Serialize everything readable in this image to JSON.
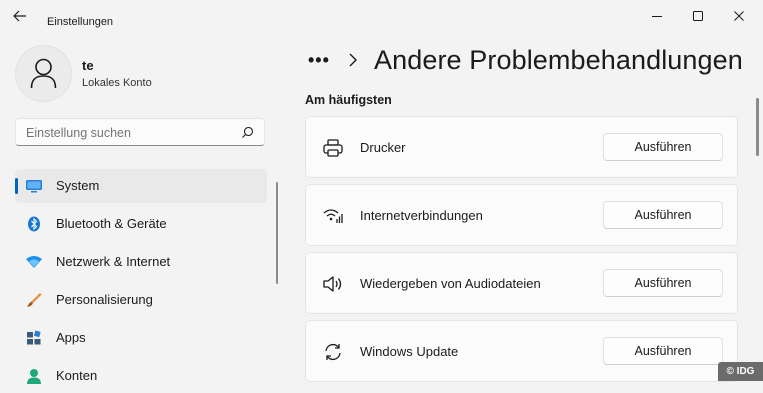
{
  "window": {
    "title": "Einstellungen"
  },
  "user": {
    "name": "te",
    "account_type": "Lokales Konto"
  },
  "search": {
    "placeholder": "Einstellung suchen"
  },
  "sidebar": {
    "items": [
      {
        "label": "System",
        "icon": "monitor-icon",
        "active": true
      },
      {
        "label": "Bluetooth & Geräte",
        "icon": "bluetooth-icon",
        "active": false
      },
      {
        "label": "Netzwerk & Internet",
        "icon": "wifi-icon",
        "active": false
      },
      {
        "label": "Personalisierung",
        "icon": "brush-icon",
        "active": false
      },
      {
        "label": "Apps",
        "icon": "apps-icon",
        "active": false
      },
      {
        "label": "Konten",
        "icon": "person-icon",
        "active": false
      }
    ]
  },
  "breadcrumb": {
    "more": "•••",
    "title": "Andere Problembehandlungen"
  },
  "section": {
    "title": "Am häufigsten"
  },
  "troubleshooters": [
    {
      "label": "Drucker",
      "icon": "printer-icon",
      "button": "Ausführen"
    },
    {
      "label": "Internetverbindungen",
      "icon": "network-icon",
      "button": "Ausführen"
    },
    {
      "label": "Wiedergeben von Audiodateien",
      "icon": "speaker-icon",
      "button": "Ausführen"
    },
    {
      "label": "Windows Update",
      "icon": "update-icon",
      "button": "Ausführen"
    }
  ],
  "watermark": "© IDG",
  "colors": {
    "accent": "#0067c0",
    "background": "#f3f3f3",
    "card": "#fbfbfb"
  }
}
